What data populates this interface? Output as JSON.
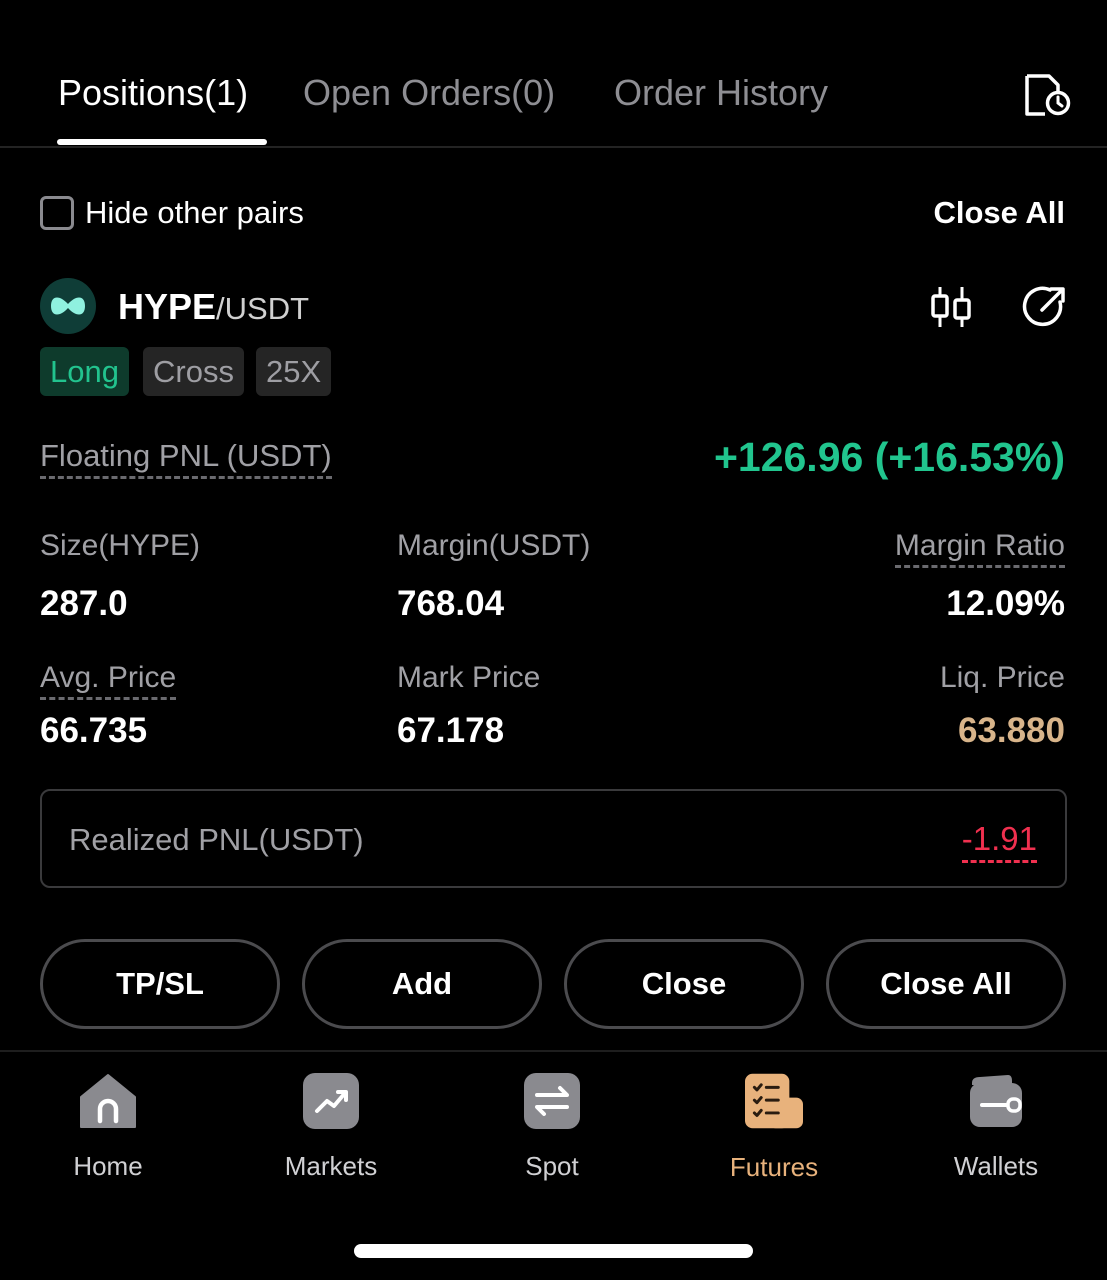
{
  "tabs": [
    {
      "label": "Positions(1)",
      "active": true
    },
    {
      "label": "Open Orders(0)",
      "active": false
    },
    {
      "label": "Order History",
      "active": false
    }
  ],
  "filter": {
    "hide_label": "Hide other pairs",
    "checked": false,
    "close_all": "Close All"
  },
  "position": {
    "base": "HYPE",
    "quote": "/USDT",
    "tags": [
      "Long",
      "Cross",
      "25X"
    ],
    "floating_pnl_label": "Floating PNL (USDT)",
    "floating_pnl_value": "+126.96 (+16.53%)",
    "size_label": "Size(HYPE)",
    "size_value": "287.0",
    "margin_label": "Margin(USDT)",
    "margin_value": "768.04",
    "margin_ratio_label": "Margin Ratio",
    "margin_ratio_value": "12.09%",
    "avg_price_label": "Avg. Price",
    "avg_price_value": "66.735",
    "mark_price_label": "Mark Price",
    "mark_price_value": "67.178",
    "liq_price_label": "Liq. Price",
    "liq_price_value": "63.880",
    "realized_label": "Realized PNL(USDT)",
    "realized_value": "-1.91"
  },
  "actions": [
    "TP/SL",
    "Add",
    "Close",
    "Close All"
  ],
  "nav": [
    {
      "label": "Home",
      "icon": "home-icon"
    },
    {
      "label": "Markets",
      "icon": "markets-icon"
    },
    {
      "label": "Spot",
      "icon": "spot-icon"
    },
    {
      "label": "Futures",
      "icon": "futures-icon",
      "active": true
    },
    {
      "label": "Wallets",
      "icon": "wallets-icon"
    }
  ],
  "colors": {
    "profit": "#21c58e",
    "loss": "#f0304f",
    "liq": "#d8b48a",
    "active_nav": "#e8b27c"
  }
}
